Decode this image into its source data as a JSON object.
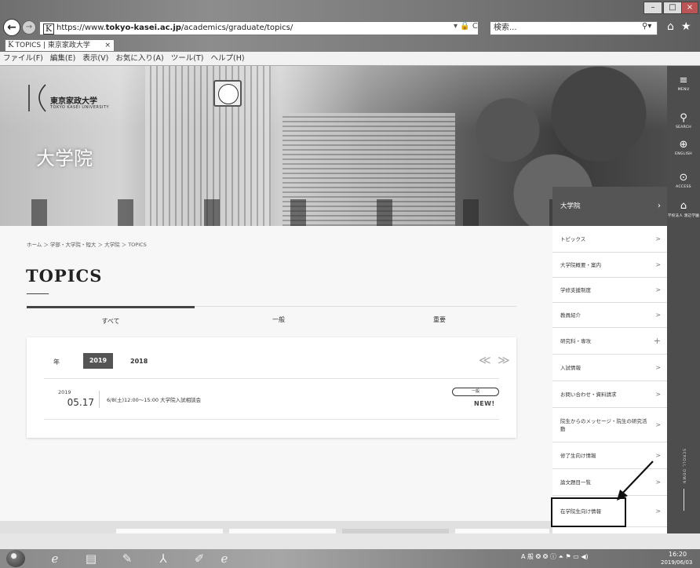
{
  "browser": {
    "url_prefix": "https://www.",
    "url_host": "tokyo-kasei.ac.jp",
    "url_path": "/academics/graduate/topics/",
    "address_icons": "▾ 🔒 C",
    "search_placeholder": "検索...",
    "tab_title": "TOPICS | 東京家政大学",
    "tab_close": "×",
    "menu": [
      "ファイル(F)",
      "編集(E)",
      "表示(V)",
      "お気に入り(A)",
      "ツール(T)",
      "ヘルプ(H)"
    ],
    "window_controls": [
      "–",
      "□",
      "×"
    ]
  },
  "site": {
    "logo_name": "東京家政大学",
    "logo_sub": "TOKYO KASEI UNIVERSITY",
    "hero_title": "大学院"
  },
  "breadcrumb": "ホーム ＞ 学部・大学院・短大 ＞ 大学院 ＞ TOPICS",
  "page_title": "TOPICS",
  "filter_tabs": [
    "すべて",
    "一般",
    "重要"
  ],
  "card": {
    "year_label": "年",
    "years": [
      "2019",
      "2018"
    ],
    "prev": "≪",
    "next": "≫",
    "news": [
      {
        "year": "2019",
        "date": "05.17",
        "title": "6/8(土)12:00～15:00 大学院入試相談会",
        "badge": "一般",
        "new_label": "NEW!"
      }
    ]
  },
  "dropdown": {
    "header": "大学院",
    "items": [
      {
        "label": "トピックス",
        "mark": ">"
      },
      {
        "label": "大学院概要・案内",
        "mark": ">"
      },
      {
        "label": "学修支援制度",
        "mark": ">"
      },
      {
        "label": "教員紹介",
        "mark": ">"
      },
      {
        "label": "研究科・専攻",
        "mark": "+"
      },
      {
        "label": "入試情報",
        "mark": ">"
      },
      {
        "label": "お問い合わせ・資料請求",
        "mark": ">"
      },
      {
        "label": "院生からのメッセージ・院生の研究活動",
        "mark": ">"
      },
      {
        "label": "修了生向け情報",
        "mark": ">"
      },
      {
        "label": "論文題目一覧",
        "mark": ">"
      },
      {
        "label": "在学院生向け情報",
        "mark": ">"
      }
    ]
  },
  "sidebar": {
    "menu": {
      "icon": "≡",
      "label": "MENU"
    },
    "search": {
      "icon": "⚲",
      "label": "SEARCH"
    },
    "english": {
      "icon": "⊕",
      "label": "ENGLISH"
    },
    "access": {
      "icon": "⊙",
      "label": "ACCESS"
    },
    "corp": {
      "icon": "⌂",
      "label": "学校法人 渡辺学園"
    },
    "scroll": "SCROLL DOWN"
  },
  "taskbar": {
    "tray_text": "A 般",
    "time": "16:20",
    "date": "2019/06/03"
  },
  "colors": {
    "dropdown_header": "#555555",
    "sidebar": "#4d4d4d",
    "year_active": "#555555"
  }
}
